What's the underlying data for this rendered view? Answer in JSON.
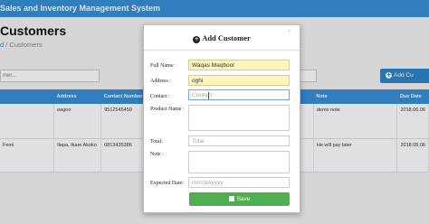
{
  "app": {
    "title": "Sales and Inventory Management System"
  },
  "page": {
    "title": "Customers"
  },
  "breadcrumb": {
    "home": "d",
    "current": "/ Customers"
  },
  "search": {
    "placeholder": "mer..."
  },
  "add_button": {
    "label": "Add Cu"
  },
  "table": {
    "headers": [
      "",
      "Address",
      "Contact Number",
      "",
      "Note",
      "Due Date"
    ],
    "rows": [
      [
        "",
        "eagoo",
        "9512545450",
        "",
        "demo note",
        "2018.06.06"
      ],
      [
        "Femi",
        "Ilepa, Ikare Akoko",
        "0813435386",
        "",
        "He will pay later",
        "2018.05.06"
      ]
    ]
  },
  "modal": {
    "title": "Add Customer",
    "close": "×",
    "labels": {
      "full_name": "Full Name :",
      "address": "Address :",
      "contact": "Contact :",
      "product": "Product Name :",
      "total": "Total:",
      "note": "Note :",
      "expected": "Expected Date:"
    },
    "values": {
      "full_name": "Waqas Maqbool",
      "address": "oghi"
    },
    "placeholders": {
      "contact": "Contact",
      "total": "Total",
      "date": "mm/dd/yyyy"
    },
    "save_label": "Save"
  },
  "colors": {
    "primary": "#3a8fd6",
    "save": "#4fae4f",
    "autofill": "#fbf6c0"
  }
}
